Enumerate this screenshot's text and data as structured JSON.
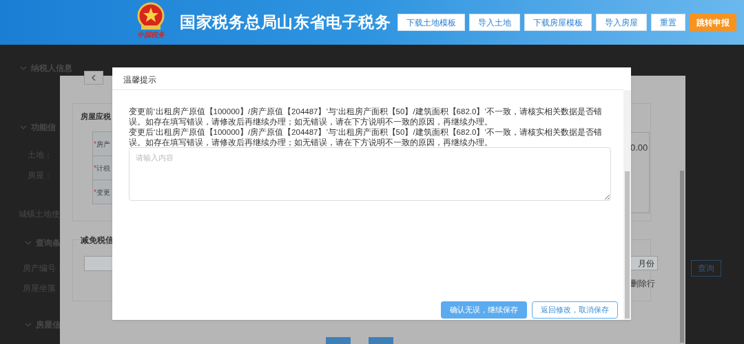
{
  "header": {
    "logo_caption": "中国税务",
    "title": "国家税务总局山东省电子税务",
    "buttons": [
      {
        "label": "下载土地模板",
        "kind": "plain"
      },
      {
        "label": "导入土地",
        "kind": "plain"
      },
      {
        "label": "下载房屋模板",
        "kind": "plain"
      },
      {
        "label": "导入房屋",
        "kind": "plain"
      },
      {
        "label": "重置",
        "kind": "plain"
      },
      {
        "label": "跳转申报",
        "kind": "primary"
      }
    ]
  },
  "page": {
    "sections": [
      {
        "kind": "heading",
        "label": "纳税人信息"
      },
      {
        "kind": "heading",
        "label": "功能信"
      },
      {
        "kind": "label",
        "label": "土地："
      },
      {
        "kind": "label",
        "label": "房屋："
      },
      {
        "kind": "plain",
        "label": "城镇土地使"
      },
      {
        "kind": "heading",
        "label": "查询条"
      },
      {
        "kind": "label",
        "label": "房产编号："
      },
      {
        "kind": "label",
        "label": "房屋坐落"
      },
      {
        "kind": "heading",
        "label": "房屋信"
      }
    ],
    "query_button": "查询"
  },
  "form": {
    "section_1": "房屋应税",
    "required_mark": "*",
    "rows": [
      {
        "label": "房产",
        "required": true
      },
      {
        "label": "计税",
        "required": true
      },
      {
        "label": "变更",
        "required": true
      }
    ],
    "amount": "0.00",
    "section_2": "减免税信",
    "month_button": "月份",
    "delete_link": "删除行"
  },
  "dialog": {
    "title": "温馨提示",
    "messages": [
      "变更前‘出租房产原值【100000】/房产原值【204487】’与‘出租房产面积【50】/建筑面积【682.0】’不一致，请核实相关数据是否错误。如存在填写错误，请修改后再继续办理；如无错误，请在下方说明不一致的原因，再继续办理。",
      "变更后‘出租房产原值【100000】/房产原值【204487】’与‘出租房产面积【50】/建筑面积【682.0】’不一致，请核实相关数据是否错误。如存在填写错误，请修改后再继续办理；如无错误，请在下方说明不一致的原因，再继续办理。"
    ],
    "reason": {
      "placeholder": "请输入内容"
    },
    "buttons": [
      {
        "label": "确认无误，继续保存",
        "kind": "primary"
      },
      {
        "label": "返回修改，取消保存",
        "kind": "outline"
      }
    ]
  }
}
